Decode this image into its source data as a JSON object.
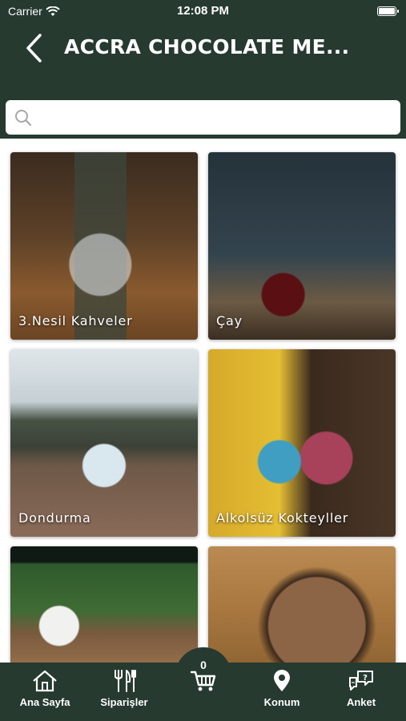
{
  "status_bar": {
    "carrier": "Carrier",
    "time": "12:08 PM"
  },
  "header": {
    "title": "ACCRA CHOCOLATE ME...",
    "back_icon": "chevron-left-icon"
  },
  "search": {
    "placeholder": "",
    "value": "",
    "icon": "search-icon"
  },
  "categories": [
    {
      "label": "3.Nesil Kahveler"
    },
    {
      "label": "Çay"
    },
    {
      "label": "Dondurma"
    },
    {
      "label": "Alkolsüz Kokteyller"
    },
    {
      "label": ""
    },
    {
      "label": ""
    }
  ],
  "tabbar": {
    "home": "Ana Sayfa",
    "orders": "Siparişler",
    "cart_count": "0",
    "location": "Konum",
    "survey": "Anket"
  },
  "colors": {
    "primary": "#263a30",
    "background": "#ffffff"
  }
}
